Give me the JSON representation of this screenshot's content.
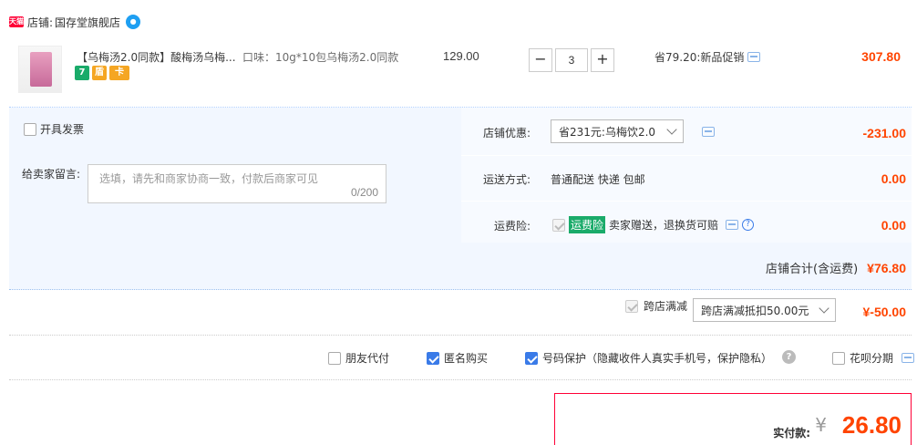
{
  "shop": {
    "label": "店铺:",
    "name": "国存堂旗舰店",
    "tmall_badge": "天猫"
  },
  "item": {
    "title": "【乌梅汤2.0同款】酸梅汤乌梅...",
    "spec": "口味：10g*10包乌梅汤2.0同款",
    "unit_price": "129.00",
    "quantity": "3",
    "minus": "−",
    "plus": "+",
    "promo": "省79.20:新品促销",
    "total": "307.80",
    "badges": [
      "7",
      "盾",
      "卡"
    ]
  },
  "invoice": {
    "label": "开具发票"
  },
  "memo": {
    "label": "给卖家留言:",
    "placeholder": "选填，请先和商家协商一致，付款后商家可见",
    "count": "0/200"
  },
  "shop_discount": {
    "label": "店铺优惠:",
    "selected": "省231元:乌梅饮2.0",
    "value": "-231.00"
  },
  "shipping": {
    "label": "运送方式:",
    "value": "普通配送 快递 包邮",
    "fee": "0.00"
  },
  "insurance": {
    "label": "运费险:",
    "tag": "运费险",
    "desc": "卖家赠送，退换货可赔",
    "fee": "0.00"
  },
  "subtotal": {
    "label": "店铺合计(含运费)",
    "value": "¥76.80"
  },
  "cross_store": {
    "label": "跨店满减",
    "selected": "跨店满减抵扣50.00元",
    "value": "¥-50.00"
  },
  "options": {
    "friend_pay": "朋友代付",
    "anonymous": "匿名购买",
    "number_protect": "号码保护（隐藏收件人真实手机号，保护隐私）",
    "huabei": "花呗分期"
  },
  "payment": {
    "label": "实付款:",
    "currency": "¥",
    "amount": "26.80"
  }
}
